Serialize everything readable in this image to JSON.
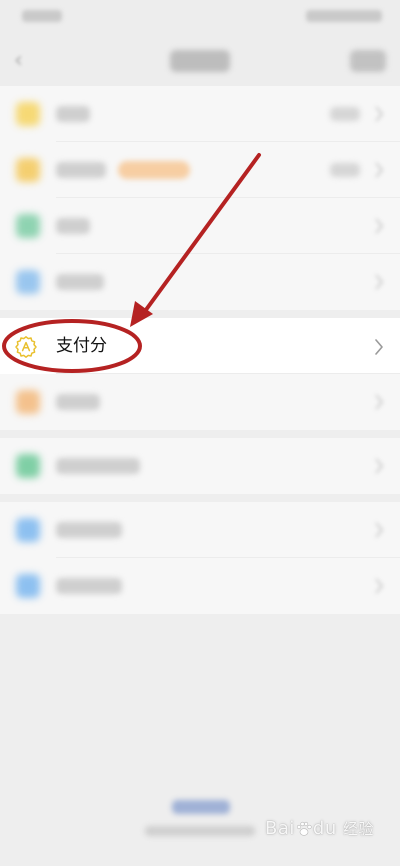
{
  "highlighted_item": {
    "label": "支付分",
    "icon": "pay-score-badge-icon",
    "chevron": "chevron-right-icon"
  },
  "blurred_items": [
    {
      "icon": "wallet-icon",
      "icon_color": "#f6cf4a",
      "has_value": true
    },
    {
      "icon": "coin-icon",
      "icon_color": "#f4c244",
      "has_value": true,
      "has_tag": true,
      "tag_color": "#f7c48e"
    },
    {
      "icon": "card-icon",
      "icon_color": "#6cc79a",
      "has_value": false
    },
    {
      "icon": "bank-card-icon",
      "icon_color": "#7ab6ec",
      "has_value": false
    },
    {
      "icon": "ticket-icon",
      "icon_color": "#f3b06a",
      "has_value": false
    },
    {
      "icon": "family-icon",
      "icon_color": "#58c28a",
      "has_value": false
    },
    {
      "icon": "shield-icon",
      "icon_color": "#6aaeee",
      "has_value": false
    },
    {
      "icon": "settings-icon",
      "icon_color": "#6aaeee",
      "has_value": false
    }
  ],
  "annotation": {
    "color": "#b52222"
  },
  "watermark": {
    "brand": "Bai",
    "brand2": "du",
    "sub": "经验"
  }
}
